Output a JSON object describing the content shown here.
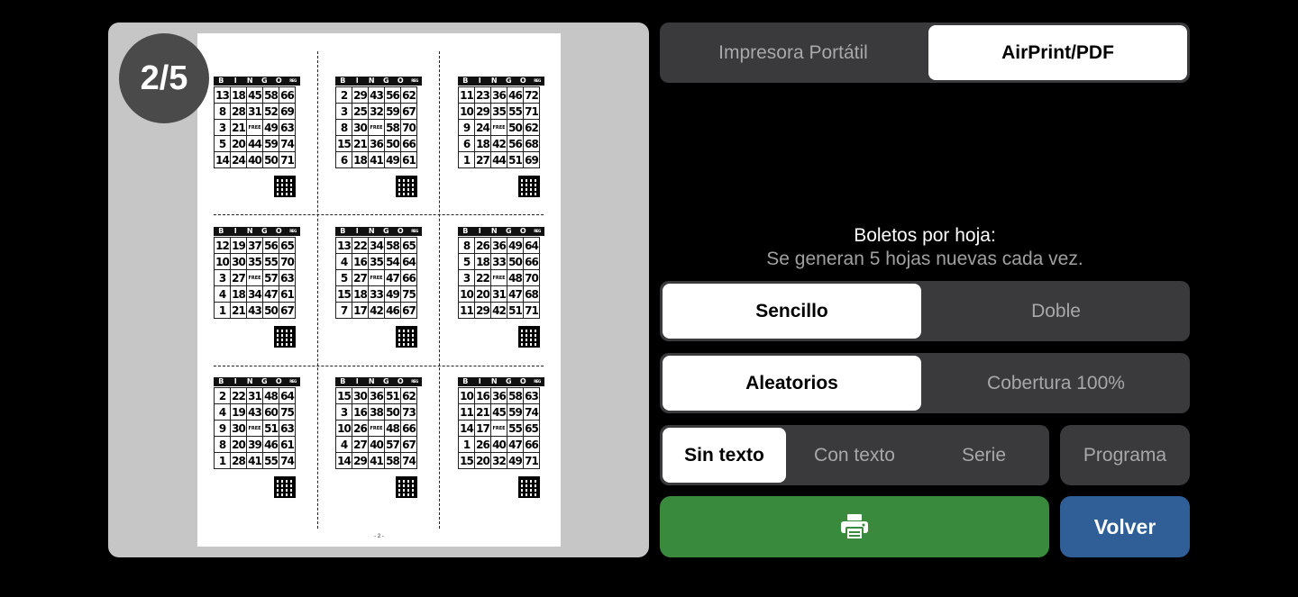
{
  "preview": {
    "page_badge": "2/5",
    "page_number": "- 2 -",
    "bingo_letters": [
      "B",
      "I",
      "N",
      "G",
      "O"
    ],
    "bingo_tag": "REG",
    "free_label": "FREE",
    "tickets": [
      [
        [
          13,
          18,
          45,
          58,
          66
        ],
        [
          8,
          28,
          31,
          52,
          69
        ],
        [
          3,
          21,
          "FREE",
          49,
          63
        ],
        [
          5,
          20,
          44,
          59,
          74
        ],
        [
          14,
          24,
          40,
          50,
          71
        ]
      ],
      [
        [
          2,
          29,
          43,
          56,
          62
        ],
        [
          3,
          25,
          32,
          59,
          67
        ],
        [
          8,
          30,
          "FREE",
          58,
          70
        ],
        [
          15,
          21,
          36,
          50,
          66
        ],
        [
          6,
          18,
          41,
          49,
          61
        ]
      ],
      [
        [
          11,
          23,
          36,
          46,
          72
        ],
        [
          10,
          29,
          35,
          55,
          71
        ],
        [
          9,
          24,
          "FREE",
          50,
          62
        ],
        [
          6,
          18,
          42,
          56,
          68
        ],
        [
          1,
          27,
          44,
          51,
          69
        ]
      ],
      [
        [
          12,
          19,
          37,
          56,
          65
        ],
        [
          10,
          30,
          35,
          55,
          70
        ],
        [
          3,
          27,
          "FREE",
          57,
          63
        ],
        [
          4,
          18,
          34,
          47,
          61
        ],
        [
          1,
          21,
          43,
          50,
          67
        ]
      ],
      [
        [
          13,
          22,
          34,
          58,
          65
        ],
        [
          4,
          16,
          35,
          54,
          64
        ],
        [
          5,
          27,
          "FREE",
          47,
          66
        ],
        [
          15,
          18,
          33,
          49,
          75
        ],
        [
          7,
          17,
          42,
          46,
          67
        ]
      ],
      [
        [
          8,
          26,
          36,
          49,
          64
        ],
        [
          5,
          18,
          33,
          50,
          66
        ],
        [
          3,
          22,
          "FREE",
          48,
          70
        ],
        [
          10,
          20,
          31,
          47,
          68
        ],
        [
          11,
          29,
          42,
          51,
          71
        ]
      ],
      [
        [
          2,
          22,
          31,
          48,
          64
        ],
        [
          4,
          19,
          43,
          60,
          75
        ],
        [
          9,
          30,
          "FREE",
          51,
          63
        ],
        [
          8,
          20,
          39,
          46,
          61
        ],
        [
          1,
          28,
          41,
          55,
          74
        ]
      ],
      [
        [
          15,
          30,
          36,
          51,
          62
        ],
        [
          3,
          16,
          38,
          50,
          73
        ],
        [
          10,
          26,
          "FREE",
          48,
          66
        ],
        [
          4,
          27,
          40,
          57,
          67
        ],
        [
          14,
          29,
          41,
          58,
          74
        ]
      ],
      [
        [
          10,
          16,
          36,
          58,
          63
        ],
        [
          11,
          21,
          45,
          59,
          74
        ],
        [
          14,
          17,
          "FREE",
          55,
          65
        ],
        [
          1,
          26,
          40,
          47,
          66
        ],
        [
          15,
          20,
          32,
          49,
          71
        ]
      ]
    ]
  },
  "printer_mode": {
    "options": [
      "Impresora Portátil",
      "AirPrint/PDF"
    ],
    "selected": 1
  },
  "tickets_per_sheet": {
    "title": "Boletos por hoja:",
    "subtitle": "Se generan 5 hojas nuevas cada vez."
  },
  "size_mode": {
    "options": [
      "Sencillo",
      "Doble"
    ],
    "selected": 0
  },
  "number_mode": {
    "options": [
      "Aleatorios",
      "Cobertura 100%"
    ],
    "selected": 0
  },
  "text_mode": {
    "options": [
      "Sin texto",
      "Con texto",
      "Serie"
    ],
    "selected": 0
  },
  "buttons": {
    "program": "Programa",
    "print_icon": "printer-icon",
    "back": "Volver"
  },
  "colors": {
    "print_button": "#3a8a3e",
    "back_button": "#2f5f96",
    "segment_bg": "#3a3a3c",
    "selected_bg": "#ffffff"
  }
}
